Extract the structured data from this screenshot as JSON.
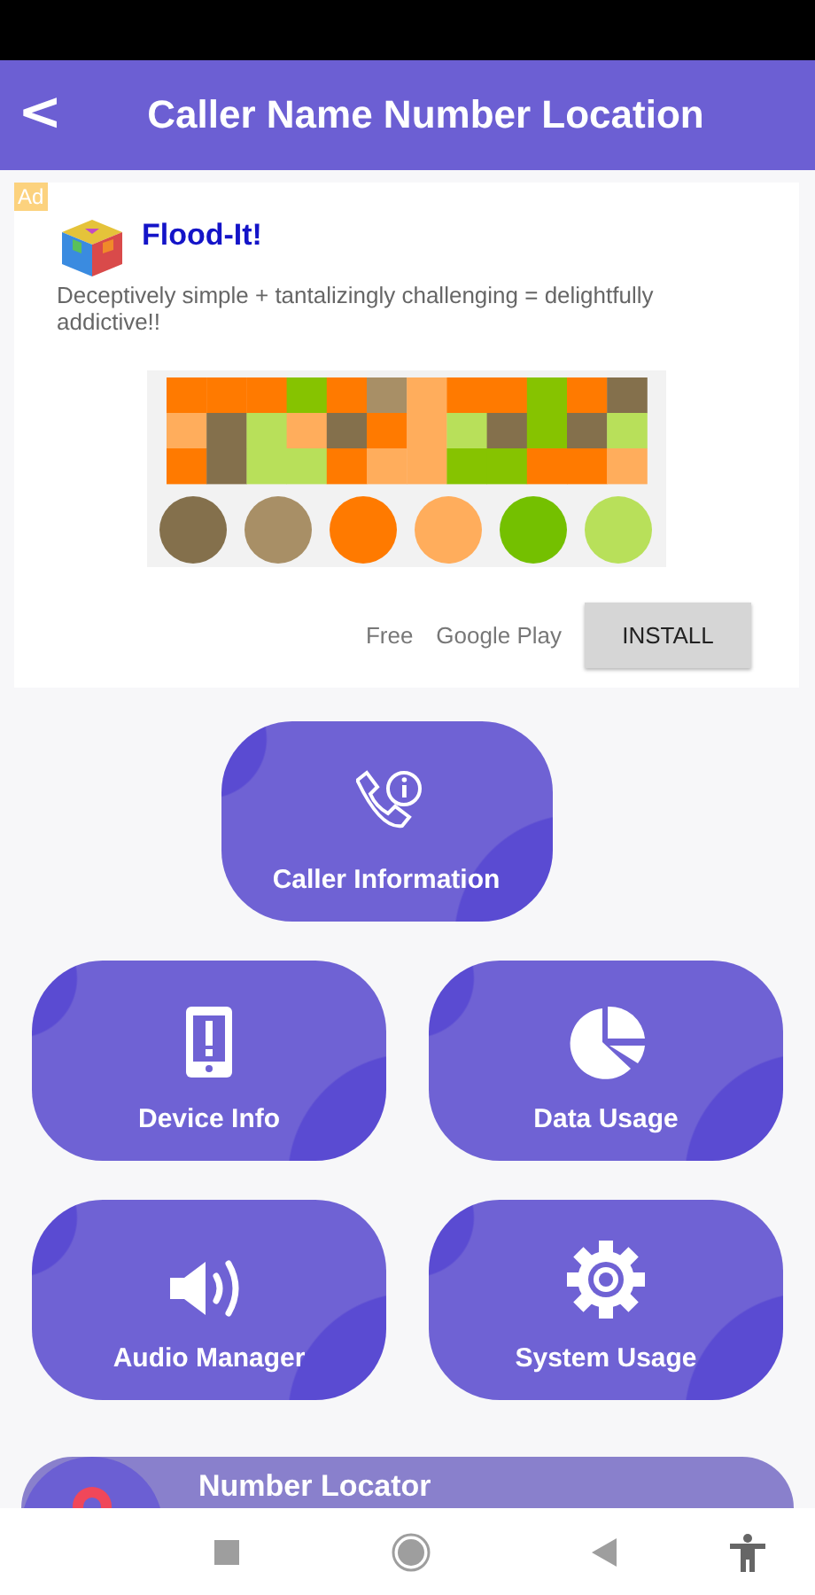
{
  "header": {
    "back": "<",
    "title": "Caller Name Number Location"
  },
  "ad": {
    "badge": "Ad",
    "app_name": "Flood-It!",
    "description": "Deceptively simple + tantalizingly challenging = delightfully addictive!!",
    "price": "Free",
    "store": "Google Play",
    "install": "INSTALL"
  },
  "tiles": [
    {
      "kind": "caller",
      "label": "Caller Information"
    },
    {
      "kind": "device",
      "label": "Device Info"
    },
    {
      "kind": "data",
      "label": "Data Usage"
    },
    {
      "kind": "audio",
      "label": "Audio Manager"
    },
    {
      "kind": "system",
      "label": "System Usage"
    }
  ],
  "locator": {
    "label": "Number Locator"
  }
}
